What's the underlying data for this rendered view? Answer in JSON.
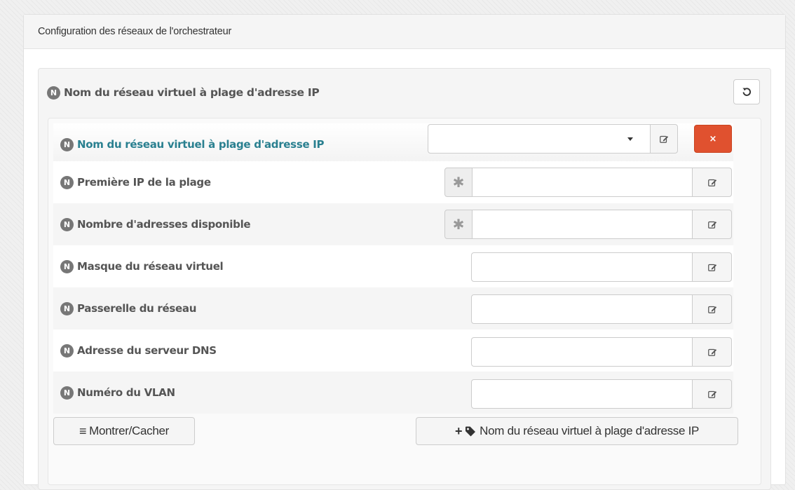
{
  "panel": {
    "title": "Configuration des réseaux de l'orchestrateur"
  },
  "badge_letter": "N",
  "group": {
    "title": "Nom du réseau virtuel à plage d'adresse IP",
    "reset_icon": "undo-icon"
  },
  "entry": {
    "title": "Nom du réseau virtuel à plage d'adresse IP",
    "select_value": "",
    "delete_icon": "×"
  },
  "fields": [
    {
      "label": "Première IP de la plage",
      "required": true,
      "value": ""
    },
    {
      "label": "Nombre d'adresses disponible",
      "required": true,
      "value": ""
    },
    {
      "label": "Masque du réseau virtuel",
      "required": false,
      "value": ""
    },
    {
      "label": "Passerelle du réseau",
      "required": false,
      "value": ""
    },
    {
      "label": "Adresse du serveur DNS",
      "required": false,
      "value": ""
    },
    {
      "label": "Numéro du VLAN",
      "required": false,
      "value": ""
    }
  ],
  "required_symbol": "✱",
  "buttons": {
    "toggle_icon": "≡",
    "toggle": "Montrer/Cacher",
    "add_icon": "+",
    "add": "Nom du réseau virtuel à plage d'adresse IP"
  },
  "colors": {
    "teal_label": "#2a8090",
    "delete_red": "#e0512f",
    "badge_gray": "#777777"
  }
}
